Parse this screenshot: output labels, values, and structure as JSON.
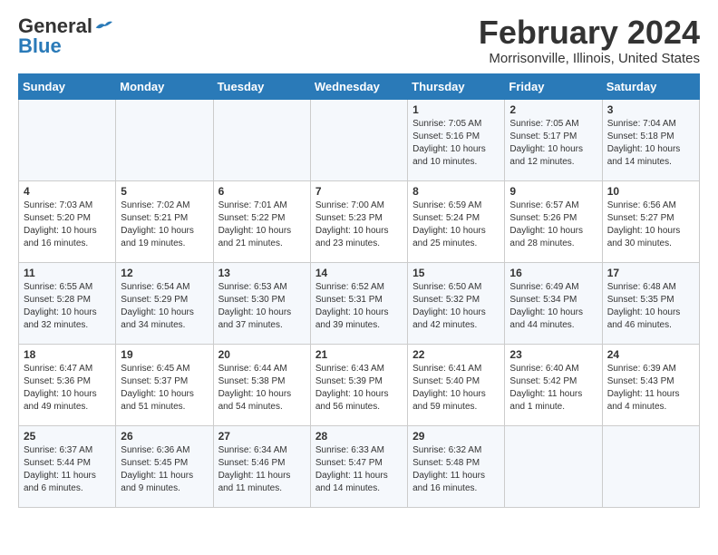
{
  "header": {
    "logo_general": "General",
    "logo_blue": "Blue",
    "month_year": "February 2024",
    "location": "Morrisonville, Illinois, United States"
  },
  "days_of_week": [
    "Sunday",
    "Monday",
    "Tuesday",
    "Wednesday",
    "Thursday",
    "Friday",
    "Saturday"
  ],
  "weeks": [
    [
      {
        "day": "",
        "info": ""
      },
      {
        "day": "",
        "info": ""
      },
      {
        "day": "",
        "info": ""
      },
      {
        "day": "",
        "info": ""
      },
      {
        "day": "1",
        "info": "Sunrise: 7:05 AM\nSunset: 5:16 PM\nDaylight: 10 hours\nand 10 minutes."
      },
      {
        "day": "2",
        "info": "Sunrise: 7:05 AM\nSunset: 5:17 PM\nDaylight: 10 hours\nand 12 minutes."
      },
      {
        "day": "3",
        "info": "Sunrise: 7:04 AM\nSunset: 5:18 PM\nDaylight: 10 hours\nand 14 minutes."
      }
    ],
    [
      {
        "day": "4",
        "info": "Sunrise: 7:03 AM\nSunset: 5:20 PM\nDaylight: 10 hours\nand 16 minutes."
      },
      {
        "day": "5",
        "info": "Sunrise: 7:02 AM\nSunset: 5:21 PM\nDaylight: 10 hours\nand 19 minutes."
      },
      {
        "day": "6",
        "info": "Sunrise: 7:01 AM\nSunset: 5:22 PM\nDaylight: 10 hours\nand 21 minutes."
      },
      {
        "day": "7",
        "info": "Sunrise: 7:00 AM\nSunset: 5:23 PM\nDaylight: 10 hours\nand 23 minutes."
      },
      {
        "day": "8",
        "info": "Sunrise: 6:59 AM\nSunset: 5:24 PM\nDaylight: 10 hours\nand 25 minutes."
      },
      {
        "day": "9",
        "info": "Sunrise: 6:57 AM\nSunset: 5:26 PM\nDaylight: 10 hours\nand 28 minutes."
      },
      {
        "day": "10",
        "info": "Sunrise: 6:56 AM\nSunset: 5:27 PM\nDaylight: 10 hours\nand 30 minutes."
      }
    ],
    [
      {
        "day": "11",
        "info": "Sunrise: 6:55 AM\nSunset: 5:28 PM\nDaylight: 10 hours\nand 32 minutes."
      },
      {
        "day": "12",
        "info": "Sunrise: 6:54 AM\nSunset: 5:29 PM\nDaylight: 10 hours\nand 34 minutes."
      },
      {
        "day": "13",
        "info": "Sunrise: 6:53 AM\nSunset: 5:30 PM\nDaylight: 10 hours\nand 37 minutes."
      },
      {
        "day": "14",
        "info": "Sunrise: 6:52 AM\nSunset: 5:31 PM\nDaylight: 10 hours\nand 39 minutes."
      },
      {
        "day": "15",
        "info": "Sunrise: 6:50 AM\nSunset: 5:32 PM\nDaylight: 10 hours\nand 42 minutes."
      },
      {
        "day": "16",
        "info": "Sunrise: 6:49 AM\nSunset: 5:34 PM\nDaylight: 10 hours\nand 44 minutes."
      },
      {
        "day": "17",
        "info": "Sunrise: 6:48 AM\nSunset: 5:35 PM\nDaylight: 10 hours\nand 46 minutes."
      }
    ],
    [
      {
        "day": "18",
        "info": "Sunrise: 6:47 AM\nSunset: 5:36 PM\nDaylight: 10 hours\nand 49 minutes."
      },
      {
        "day": "19",
        "info": "Sunrise: 6:45 AM\nSunset: 5:37 PM\nDaylight: 10 hours\nand 51 minutes."
      },
      {
        "day": "20",
        "info": "Sunrise: 6:44 AM\nSunset: 5:38 PM\nDaylight: 10 hours\nand 54 minutes."
      },
      {
        "day": "21",
        "info": "Sunrise: 6:43 AM\nSunset: 5:39 PM\nDaylight: 10 hours\nand 56 minutes."
      },
      {
        "day": "22",
        "info": "Sunrise: 6:41 AM\nSunset: 5:40 PM\nDaylight: 10 hours\nand 59 minutes."
      },
      {
        "day": "23",
        "info": "Sunrise: 6:40 AM\nSunset: 5:42 PM\nDaylight: 11 hours\nand 1 minute."
      },
      {
        "day": "24",
        "info": "Sunrise: 6:39 AM\nSunset: 5:43 PM\nDaylight: 11 hours\nand 4 minutes."
      }
    ],
    [
      {
        "day": "25",
        "info": "Sunrise: 6:37 AM\nSunset: 5:44 PM\nDaylight: 11 hours\nand 6 minutes."
      },
      {
        "day": "26",
        "info": "Sunrise: 6:36 AM\nSunset: 5:45 PM\nDaylight: 11 hours\nand 9 minutes."
      },
      {
        "day": "27",
        "info": "Sunrise: 6:34 AM\nSunset: 5:46 PM\nDaylight: 11 hours\nand 11 minutes."
      },
      {
        "day": "28",
        "info": "Sunrise: 6:33 AM\nSunset: 5:47 PM\nDaylight: 11 hours\nand 14 minutes."
      },
      {
        "day": "29",
        "info": "Sunrise: 6:32 AM\nSunset: 5:48 PM\nDaylight: 11 hours\nand 16 minutes."
      },
      {
        "day": "",
        "info": ""
      },
      {
        "day": "",
        "info": ""
      }
    ]
  ]
}
